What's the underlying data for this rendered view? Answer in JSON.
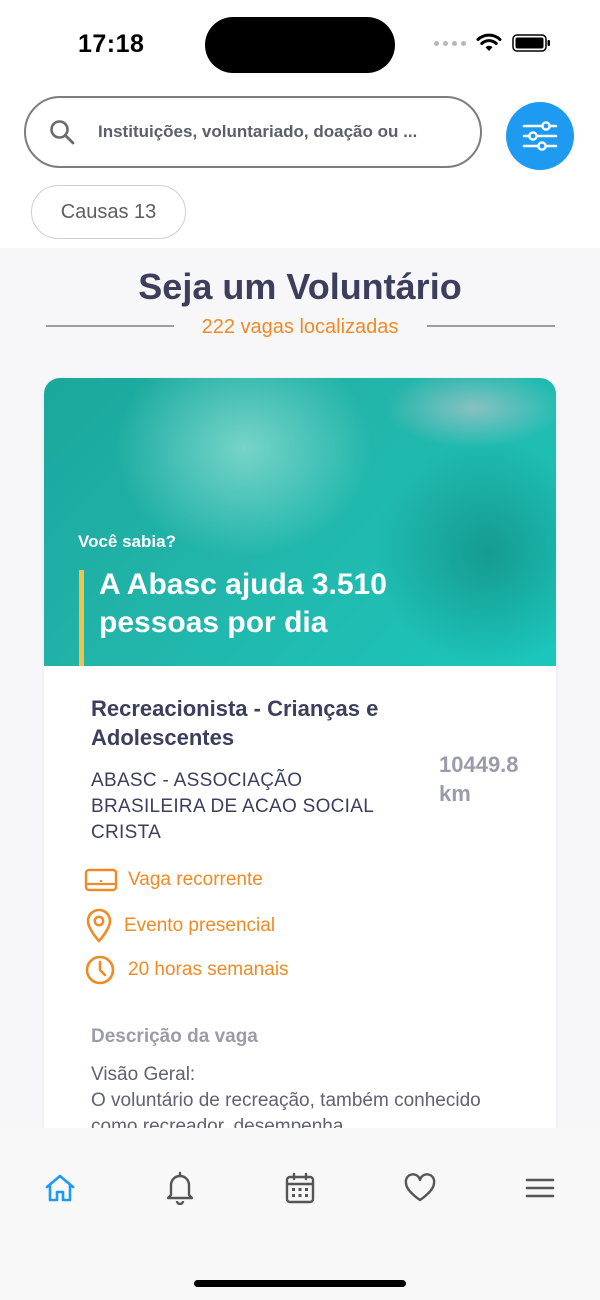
{
  "status_bar": {
    "time": "17:18"
  },
  "search": {
    "placeholder": "Instituições, voluntariado, doação ou ..."
  },
  "filter_chip": {
    "label": "Causas 13"
  },
  "section": {
    "title": "Seja um Voluntário",
    "count_text": "222 vagas localizadas"
  },
  "card": {
    "image": {
      "kicker": "Você sabia?",
      "headline": "A Abasc ajuda 3.510 pessoas por dia"
    },
    "title": "Recreacionista - Crianças e Adolescentes",
    "organization": "ABASC - ASSOCIAÇÃO BRASILEIRA DE ACAO SOCIAL CRISTA",
    "distance": "10449.8 km",
    "type": "Vaga recorrente",
    "mode": "Evento presencial",
    "hours": "20 horas semanais",
    "description_heading": "Descrição da vaga",
    "description": "Visão Geral:\nO voluntário de recreação, também conhecido como recreador, desempenha"
  },
  "nav": {
    "items": [
      "home-icon",
      "bell-icon",
      "calendar-icon",
      "heart-icon",
      "menu-icon"
    ],
    "active": "home-icon"
  },
  "colors": {
    "accent_blue": "#1e9af0",
    "accent_orange": "#f08a24",
    "title_dark": "#3b3f5c",
    "muted_gray": "#9a9cab"
  }
}
